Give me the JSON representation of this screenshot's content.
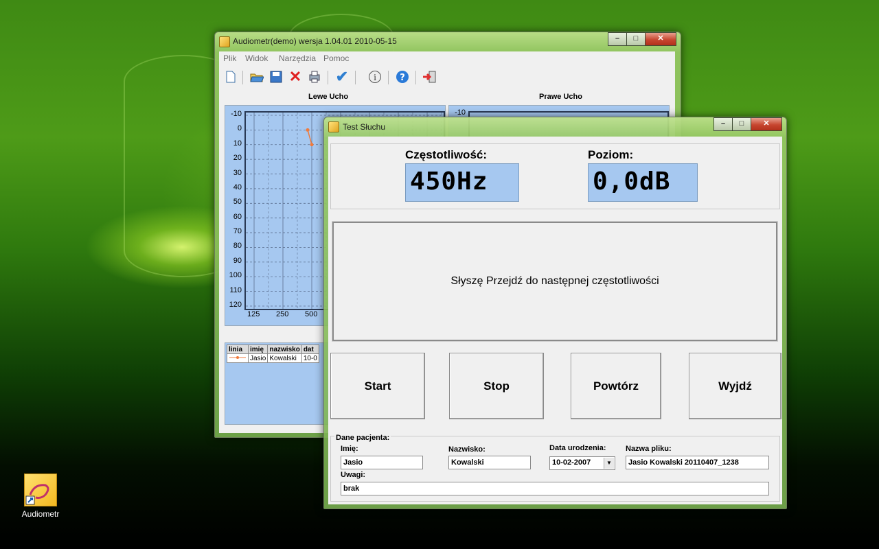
{
  "desktop": {
    "icon_label": "Audiometr"
  },
  "main_window": {
    "title": "Audiometr(demo) wersja 1.04.01 2010-05-15",
    "menu": [
      "Plik",
      "Widok",
      "Narzędzia",
      "Pomoc"
    ],
    "toolbar_icons": [
      "new-file-icon",
      "open-folder-icon",
      "save-icon",
      "delete-icon",
      "print-icon",
      "check-icon",
      "info-icon",
      "help-icon",
      "exit-icon"
    ],
    "left_panel_title": "Lewe Ucho",
    "right_panel_title": "Prawe Ucho",
    "y_ticks": [
      "-10",
      "0",
      "10",
      "20",
      "30",
      "40",
      "50",
      "60",
      "70",
      "80",
      "90",
      "100",
      "110",
      "120"
    ],
    "x_ticks": [
      "125",
      "250",
      "500"
    ],
    "right_y_tick_top": "-10",
    "legend_headers": [
      "linia",
      "imię",
      "nazwisko",
      "dat"
    ],
    "legend_row": {
      "imie": "Jasio",
      "nazwisko": "Kowalski",
      "data": "10-0"
    }
  },
  "chart_data": {
    "type": "line",
    "title": "Lewe Ucho",
    "xlabel": "",
    "ylabel": "",
    "ylim": [
      120,
      -10
    ],
    "x_categories_visible": [
      "125",
      "250",
      "500"
    ],
    "series": [
      {
        "values": [
          {
            "x": "500",
            "y": 0
          },
          {
            "x": "500",
            "y": 10
          }
        ],
        "color": "#f07a3c"
      }
    ]
  },
  "test_dialog": {
    "title": "Test Słuchu",
    "frequency_label": "Częstotliwość:",
    "frequency_value": "450Hz",
    "level_label": "Poziom:",
    "level_value": "0,0dB",
    "message": "Słyszę Przejdź do następnej częstotliwości",
    "buttons": {
      "start": "Start",
      "stop": "Stop",
      "repeat": "Powtórz",
      "exit": "Wyjdź"
    },
    "patient": {
      "group_label": "Dane pacjenta:",
      "first_name_label": "Imię:",
      "first_name_value": "Jasio",
      "last_name_label": "Nazwisko:",
      "last_name_value": "Kowalski",
      "birth_label": "Data urodzenia:",
      "birth_value": "10-02-2007",
      "file_label": "Nazwa pliku:",
      "file_value": "Jasio Kowalski 20110407_1238",
      "notes_label": "Uwagi:",
      "notes_value": "brak"
    }
  },
  "colors": {
    "chart_bg": "#a6c8f0",
    "series_line": "#f07a3c",
    "close_button": "#c74630"
  }
}
